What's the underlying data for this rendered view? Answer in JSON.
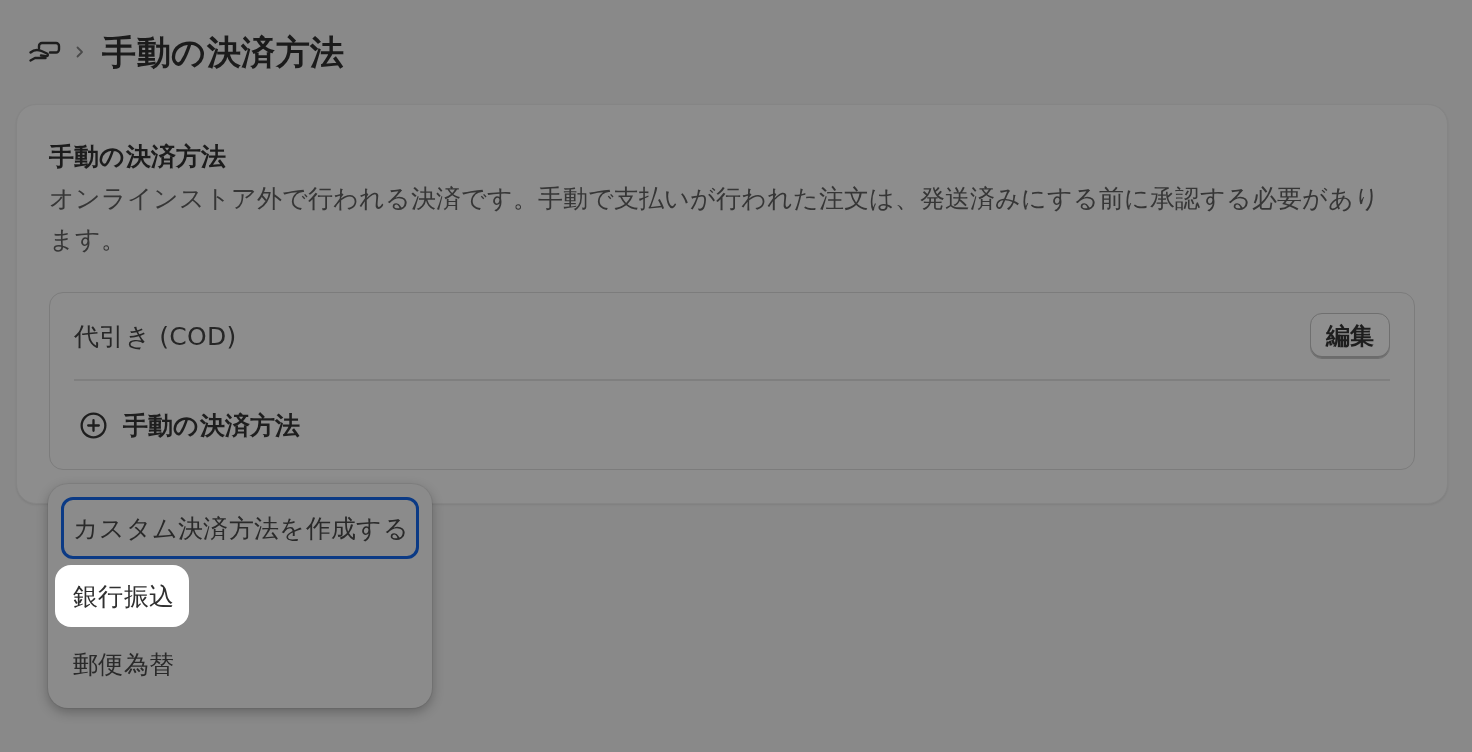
{
  "breadcrumb": {
    "title": "手動の決済方法"
  },
  "card": {
    "title": "手動の決済方法",
    "description": "オンラインストア外で行われる決済です。手動で支払いが行われた注文は、発送済みにする前に承認する必要があります。",
    "methods": [
      {
        "name": "代引き (COD)",
        "action": "編集"
      }
    ],
    "add_button": "手動の決済方法"
  },
  "menu": {
    "items": [
      {
        "label": "カスタム決済方法を作成する",
        "focused": true,
        "highlighted": false
      },
      {
        "label": "銀行振込",
        "focused": false,
        "highlighted": true
      },
      {
        "label": "郵便為替",
        "focused": false,
        "highlighted": false
      }
    ]
  }
}
